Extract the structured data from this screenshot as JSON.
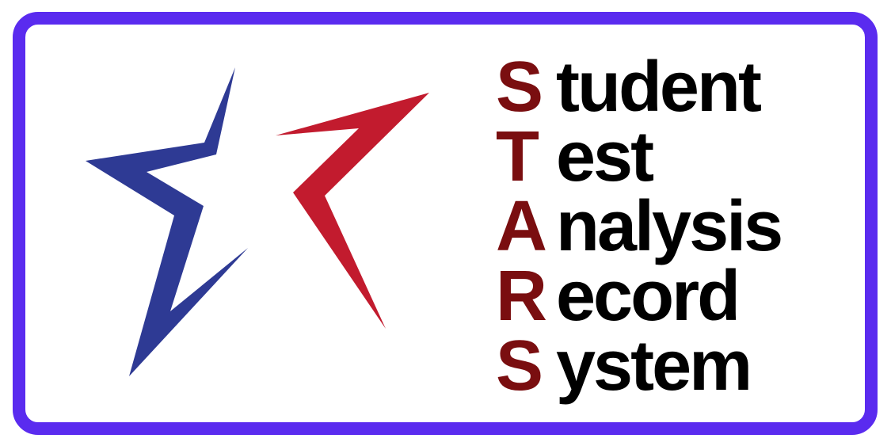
{
  "logo": {
    "colors": {
      "border": "#5a2bef",
      "blue_star": "#2e3a94",
      "red_star": "#c21b2e",
      "initials": "#7a0e10",
      "words": "#000000"
    },
    "lines": [
      {
        "initial": "S",
        "rest": "tudent"
      },
      {
        "initial": "T",
        "rest": "est"
      },
      {
        "initial": "A",
        "rest": "nalysis"
      },
      {
        "initial": "R",
        "rest": "ecord"
      },
      {
        "initial": "S",
        "rest": "ystem"
      }
    ]
  }
}
